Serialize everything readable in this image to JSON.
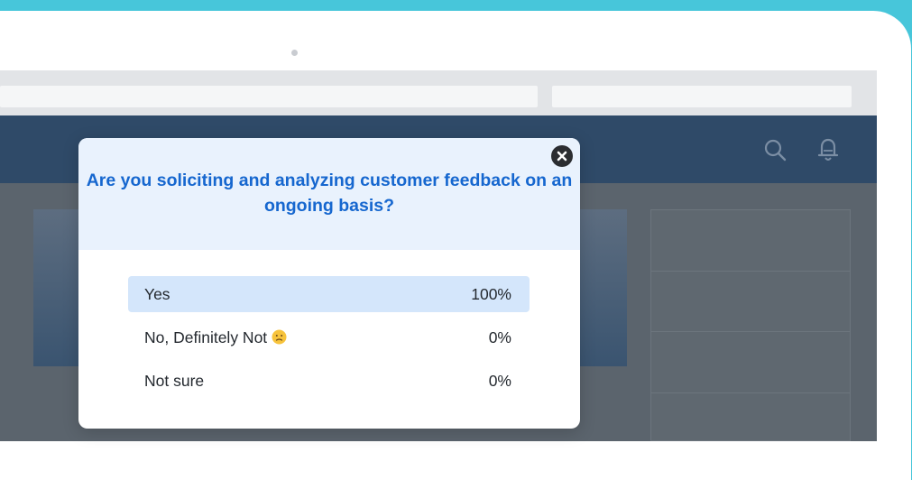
{
  "colors": {
    "background_accent": "#47c6da",
    "app_header": "#2f4a68",
    "question_text": "#1667cf",
    "selected_answer": "#d4e6fb"
  },
  "header_icons": [
    "search-icon",
    "bell-icon"
  ],
  "survey": {
    "question": "Are you soliciting and analyzing customer feedback on an ongoing basis?",
    "close_icon": "close-icon",
    "answers": [
      {
        "label": "Yes",
        "percent": "100%",
        "selected": true
      },
      {
        "label": "No, Definitely Not",
        "emoji": "confused-face-icon",
        "percent": "0%"
      },
      {
        "label": "Not sure",
        "percent": "0%"
      }
    ]
  }
}
